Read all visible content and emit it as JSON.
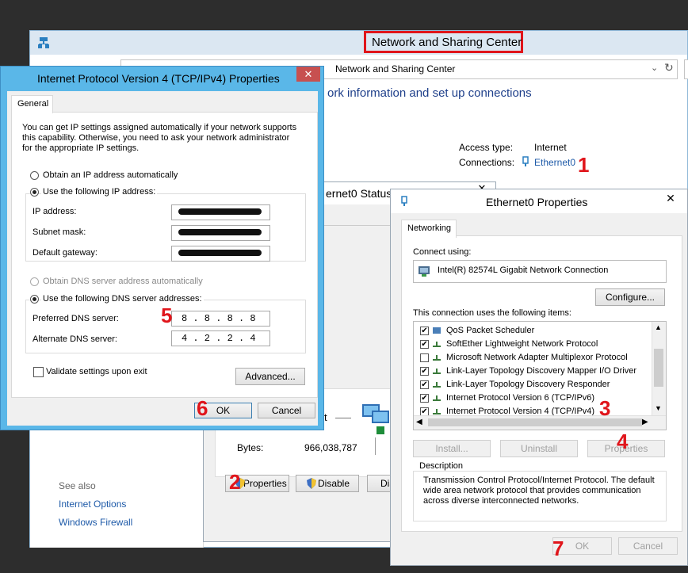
{
  "nsc": {
    "title": "Network and Sharing Center",
    "address": "Network and Sharing Center",
    "heading": "ork information and set up connections",
    "access_type_label": "Access type:",
    "access_type_value": "Internet",
    "connections_label": "Connections:",
    "connections_value": "Ethernet0",
    "see_also": "See also",
    "internet_options": "Internet Options",
    "windows_firewall": "Windows Firewall"
  },
  "status": {
    "title": "ernet0 Status",
    "bytes_label": "Bytes:",
    "bytes_value": "966,038,787",
    "t_char": "t",
    "properties_btn": "Properties",
    "disable_btn": "Disable",
    "diag_btn": "Dia"
  },
  "ipv4": {
    "title": "Internet Protocol Version 4 (TCP/IPv4) Properties",
    "tab": "General",
    "intro": "You can get IP settings assigned automatically if your network supports this capability. Otherwise, you need to ask your network administrator for the appropriate IP settings.",
    "obtain_ip_auto": "Obtain an IP address automatically",
    "use_following_ip": "Use the following IP address:",
    "ip_address_label": "IP address:",
    "subnet_mask_label": "Subnet mask:",
    "default_gateway_label": "Default gateway:",
    "obtain_dns_auto": "Obtain DNS server address automatically",
    "use_following_dns": "Use the following DNS server addresses:",
    "preferred_dns_label": "Preferred DNS server:",
    "preferred_dns_value": "8 . 8 . 8 . 8",
    "alternate_dns_label": "Alternate DNS server:",
    "alternate_dns_value": "4 . 2 . 2 . 4",
    "validate_label": "Validate settings upon exit",
    "advanced_btn": "Advanced...",
    "ok_btn": "OK",
    "cancel_btn": "Cancel"
  },
  "eth": {
    "title": "Ethernet0 Properties",
    "tab": "Networking",
    "connect_using_label": "Connect using:",
    "adapter": "Intel(R) 82574L Gigabit Network Connection",
    "configure_btn": "Configure...",
    "items_label": "This connection uses the following items:",
    "items": [
      {
        "label": "QoS Packet Scheduler",
        "checked": "✔"
      },
      {
        "label": "SoftEther Lightweight Network Protocol",
        "checked": "✔"
      },
      {
        "label": "Microsoft Network Adapter Multiplexor Protocol",
        "checked": ""
      },
      {
        "label": "Link-Layer Topology Discovery Mapper I/O Driver",
        "checked": "✔"
      },
      {
        "label": "Link-Layer Topology Discovery Responder",
        "checked": "✔"
      },
      {
        "label": "Internet Protocol Version 6 (TCP/IPv6)",
        "checked": "✔"
      },
      {
        "label": "Internet Protocol Version 4 (TCP/IPv4)",
        "checked": "✔"
      }
    ],
    "install_btn": "Install...",
    "uninstall_btn": "Uninstall",
    "properties_btn": "Properties",
    "description_label": "Description",
    "description": "Transmission Control Protocol/Internet Protocol. The default wide area network protocol that provides communication across diverse interconnected networks.",
    "ok_btn": "OK",
    "cancel_btn": "Cancel"
  },
  "steps": {
    "s1": "1",
    "s2": "2",
    "s3": "3",
    "s4": "4",
    "s5": "5",
    "s6": "6",
    "s7": "7"
  },
  "colors": {
    "accent": "#1e5aa8",
    "highlight": "#e0151b",
    "dialog_frame": "#5ab7e8"
  }
}
